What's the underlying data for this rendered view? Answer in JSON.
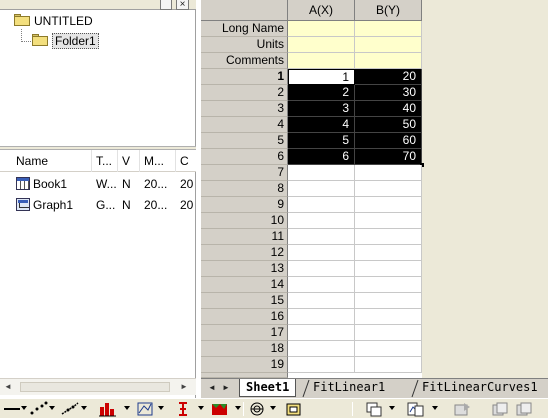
{
  "explorer": {
    "close_glyph": "×",
    "tree": {
      "root": "UNTITLED",
      "child": "Folder1"
    },
    "list_columns": [
      "Name",
      "T...",
      "V",
      "M...",
      "C"
    ],
    "items": [
      {
        "name": "Book1",
        "type": "W...",
        "view": "N",
        "modified": "20...",
        "created": "20",
        "icon": "workbook-icon"
      },
      {
        "name": "Graph1",
        "type": "G...",
        "view": "N",
        "modified": "20...",
        "created": "20",
        "icon": "graph-icon"
      }
    ],
    "scroll_left": "◄",
    "scroll_right": "►"
  },
  "worksheet": {
    "columns": [
      "A(X)",
      "B(Y)"
    ],
    "meta_rows": [
      "Long Name",
      "Units",
      "Comments"
    ],
    "data_rows": [
      {
        "row": "1",
        "a": "1",
        "b": "20"
      },
      {
        "row": "2",
        "a": "2",
        "b": "30"
      },
      {
        "row": "3",
        "a": "3",
        "b": "40"
      },
      {
        "row": "4",
        "a": "4",
        "b": "50"
      },
      {
        "row": "5",
        "a": "5",
        "b": "60"
      },
      {
        "row": "6",
        "a": "6",
        "b": "70"
      }
    ],
    "empty_rows": [
      "7",
      "8",
      "9",
      "10",
      "11",
      "12",
      "13",
      "14",
      "15",
      "16",
      "17",
      "18",
      "19"
    ],
    "selection": "A1:B6"
  },
  "tabs": {
    "nav_left": "◄",
    "nav_right": "►",
    "items": [
      "Sheet1",
      "FitLinear1",
      "FitLinearCurves1"
    ],
    "active": "Sheet1"
  },
  "toolbar": {
    "icons": [
      "scatter-plot-icon",
      "line-plot-icon",
      "column-plot-icon",
      "axis-plot-icon",
      "error-bar-icon",
      "3d-surface-icon",
      "polar-icon",
      "template-icon",
      "layer-icon",
      "merge-graph-icon",
      "export-icon",
      "copy-page-icon"
    ],
    "colors": {
      "red": "#cc0000",
      "green": "#2a8c2a",
      "blue": "#1e3c8c"
    }
  }
}
